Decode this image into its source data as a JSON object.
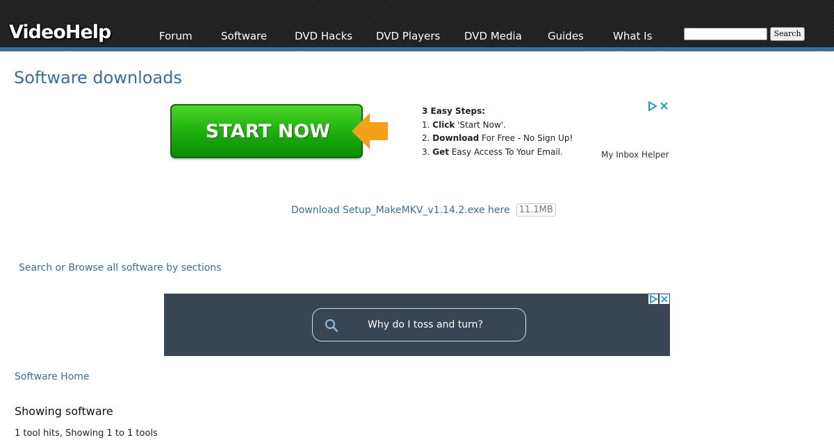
{
  "header": {
    "logo": "VideoHelp",
    "nav": [
      "Forum",
      "Software",
      "DVD Hacks",
      "DVD Players",
      "DVD Media",
      "Guides",
      "What Is"
    ],
    "search": {
      "placeholder": "",
      "button_label": "Search"
    }
  },
  "main": {
    "title": "Software downloads",
    "ad1": {
      "button_label": "START NOW",
      "steps_title": "3 Easy Steps:",
      "steps": [
        {
          "num": "1.",
          "bold": "Click",
          "rest": " 'Start Now'."
        },
        {
          "num": "2.",
          "bold": "Download",
          "rest": " For Free - No Sign Up!"
        },
        {
          "num": "3.",
          "bold": "Get",
          "rest": " Easy Access To Your Email."
        }
      ],
      "sponsor": "My Inbox Helper"
    },
    "download": {
      "link": "Download Setup_MakeMKV_v1.14.2.exe here",
      "size": "11.1MB"
    },
    "browse_link": "Search or Browse all software by sections",
    "ad2": {
      "query": "Why do I toss and turn?"
    },
    "home_link": "Software Home",
    "showing_title": "Showing software",
    "hits": "1 tool hits, Showing 1 to 1 tools"
  },
  "colors": {
    "link": "#3a6d99",
    "header_bg": "#222222",
    "header_line": "#3a6d99",
    "ad2_bg": "#3a4553",
    "cta_green": "#22b410",
    "arrow_orange": "#f5a01a"
  }
}
